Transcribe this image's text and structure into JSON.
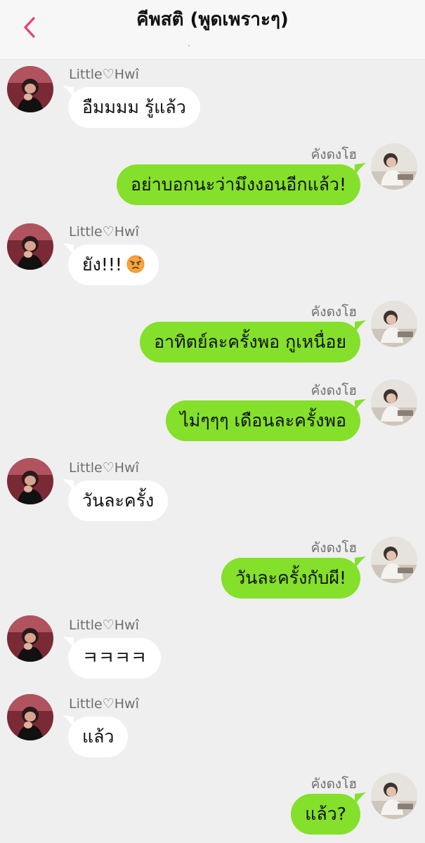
{
  "header": {
    "title": "คีพสติ (พูดเพราะๆ)"
  },
  "colors": {
    "accent": "#e8407a",
    "outgoing_bubble": "#84e02a",
    "incoming_bubble": "#ffffff",
    "background": "#efefef"
  },
  "messages": [
    {
      "direction": "in",
      "sender": "Little♡Hwî",
      "text": "อืมมมม รู้แล้ว"
    },
    {
      "direction": "out",
      "sender": "คังดงโฮ",
      "text": "อย่าบอกนะว่ามึงงอนอีกแล้ว!"
    },
    {
      "direction": "in",
      "sender": "Little♡Hwî",
      "text": "ยัง!!!",
      "emoji": "angry-face-emoji"
    },
    {
      "direction": "out",
      "sender": "คังดงโฮ",
      "text": "อาทิตย์ละครั้งพอ กูเหนื่อย"
    },
    {
      "direction": "out",
      "sender": "คังดงโฮ",
      "text": "ไม่ๆๆๆ เดือนละครั้งพอ"
    },
    {
      "direction": "in",
      "sender": "Little♡Hwî",
      "text": "วันละครั้ง"
    },
    {
      "direction": "out",
      "sender": "คังดงโฮ",
      "text": "วันละครั้งกับผี!"
    },
    {
      "direction": "in",
      "sender": "Little♡Hwî",
      "text": "ㅋㅋㅋㅋ"
    },
    {
      "direction": "in",
      "sender": "Little♡Hwî",
      "text": "แล้ว"
    },
    {
      "direction": "out",
      "sender": "คังดงโฮ",
      "text": "แล้ว?"
    }
  ]
}
